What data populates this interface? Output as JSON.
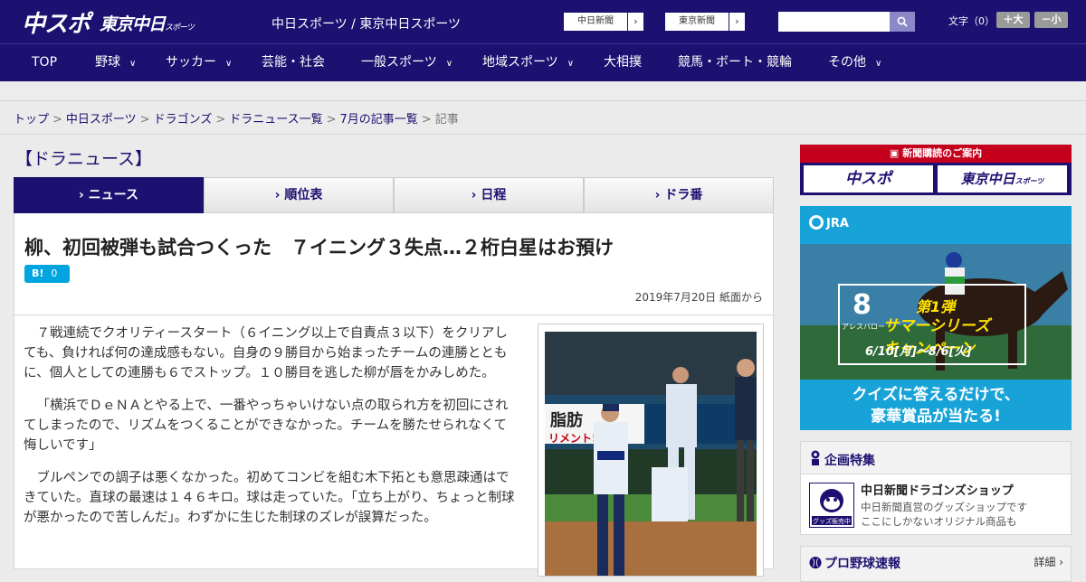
{
  "header": {
    "logo_chuspo": "中スポ",
    "logo_tokyo": "東京中日",
    "logo_tokyo_small": "スポーツ",
    "site_title": "中日スポーツ / 東京中日スポーツ",
    "links": [
      "中日新聞",
      "東京新聞"
    ],
    "link_arrow": "›",
    "search_placeholder": "",
    "search_icon": "search-icon",
    "font_label": "文字（0）",
    "font_up": "＋大",
    "font_down": "－小"
  },
  "nav": {
    "items": [
      "TOP",
      "野球",
      "サッカー",
      "芸能・社会",
      "一般スポーツ",
      "地域スポーツ",
      "大相撲",
      "競馬・ボート・競輪",
      "その他"
    ],
    "chevron": "∨"
  },
  "breadcrumb": {
    "items": [
      "トップ",
      "中日スポーツ",
      "ドラゴンズ",
      "ドラニュース一覧",
      "7月の記事一覧"
    ],
    "current": "記事",
    "separator": ">"
  },
  "section_title": "【ドラニュース】",
  "tabs": [
    "› ニュース",
    "› 順位表",
    "› 日程",
    "› ドラ番"
  ],
  "article": {
    "headline": "柳、初回被弾も試合つくった　７イニング３失点…２桁白星はお預け",
    "hatena_label": "B!",
    "hatena_count": "0",
    "date": "2019年7月20日 紙面から",
    "paragraphs": [
      "７戦連続でクオリティースタート（６イニング以上で自責点３以下）をクリアしても、負ければ何の達成感もない。自身の９勝目から始まったチームの連勝とともに、個人としての連勝も６でストップ。１０勝目を逃した柳が唇をかみしめた。",
      "「横浜でＤｅＮＡとやる上で、一番やっちゃいけない点の取られ方を初回にされてしまったので、リズムをつくることができなかった。チームを勝たせられなくて悔しいです」",
      "ブルペンでの調子は悪くなかった。初めてコンビを組む木下拓とも意思疎通はできていた。直球の最速は１４６キロ。球は走っていた。「立ち上がり、ちょっと制球が悪かったので苦しんだ」。わずかに生じた制球のズレが誤算だった。"
    ],
    "photo_sign_1": "脂肪",
    "photo_sign_2": "リメント!"
  },
  "sidebar": {
    "subscribe_head": "新聞購読のご案内",
    "subscribe_logos": [
      "中スポ",
      "東京中日"
    ],
    "subscribe_logo_small": "スポーツ",
    "jra": {
      "logo": "JRA",
      "number": "8",
      "sub": "アレスバロー",
      "title_1": "第1弾",
      "title_2": "サマーシリーズ",
      "title_3": "キャンペーン",
      "dates": "6/10[月]～8/6[火]",
      "copy_1": "クイズに答えるだけで、",
      "copy_2": "豪華賞品が当たる!"
    },
    "special": {
      "title": "企画特集",
      "shop_name": "中日新聞ドラゴンズショップ",
      "shop_desc_1": "中日新聞直営のグッズショップです",
      "shop_desc_2": "ここにしかないオリジナル商品も",
      "shop_badge": "グッズ販売中"
    },
    "baseball": {
      "title": "プロ野球速報",
      "more": "詳細 ›"
    }
  },
  "colors": {
    "brand_navy": "#1c1070",
    "subscribe_red": "#c4001c",
    "jra_blue": "#18a3d8",
    "hatena_blue": "#00a4de"
  }
}
